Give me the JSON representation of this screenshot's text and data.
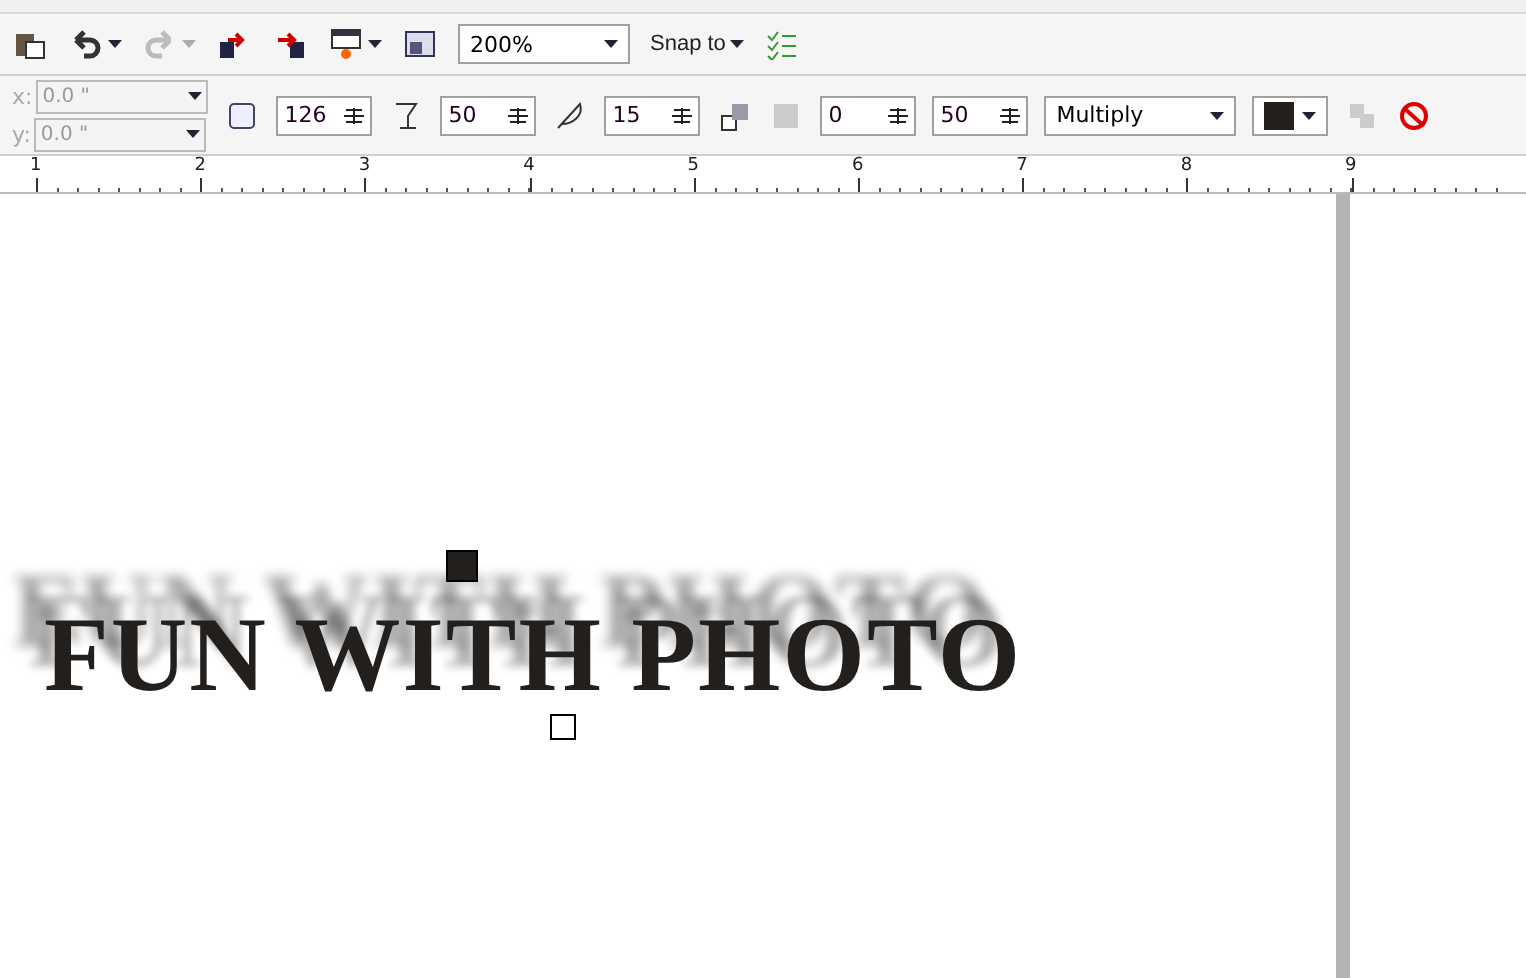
{
  "toolbar": {
    "undo": {
      "disabled": false
    },
    "redo": {
      "disabled": true
    },
    "zoom": "200%",
    "snap": "Snap to"
  },
  "property_bar": {
    "x": {
      "label": "x:",
      "value": "0.0 \"",
      "disabled": true
    },
    "y": {
      "label": "y:",
      "value": "0.0 \"",
      "disabled": true
    },
    "fields": [
      {
        "kind": "distance",
        "value": "126"
      },
      {
        "kind": "opacity",
        "value": "50"
      },
      {
        "kind": "feather",
        "value": "15"
      }
    ],
    "offsets": [
      {
        "value": "0"
      },
      {
        "value": "50"
      }
    ],
    "mode": "Multiply",
    "color": "#231f1c"
  },
  "ruler": {
    "labels": [
      "1",
      "2",
      "3",
      "4",
      "5",
      "6",
      "7",
      "8",
      "9"
    ]
  },
  "canvas": {
    "text": "FUN WITH PHOTO"
  }
}
